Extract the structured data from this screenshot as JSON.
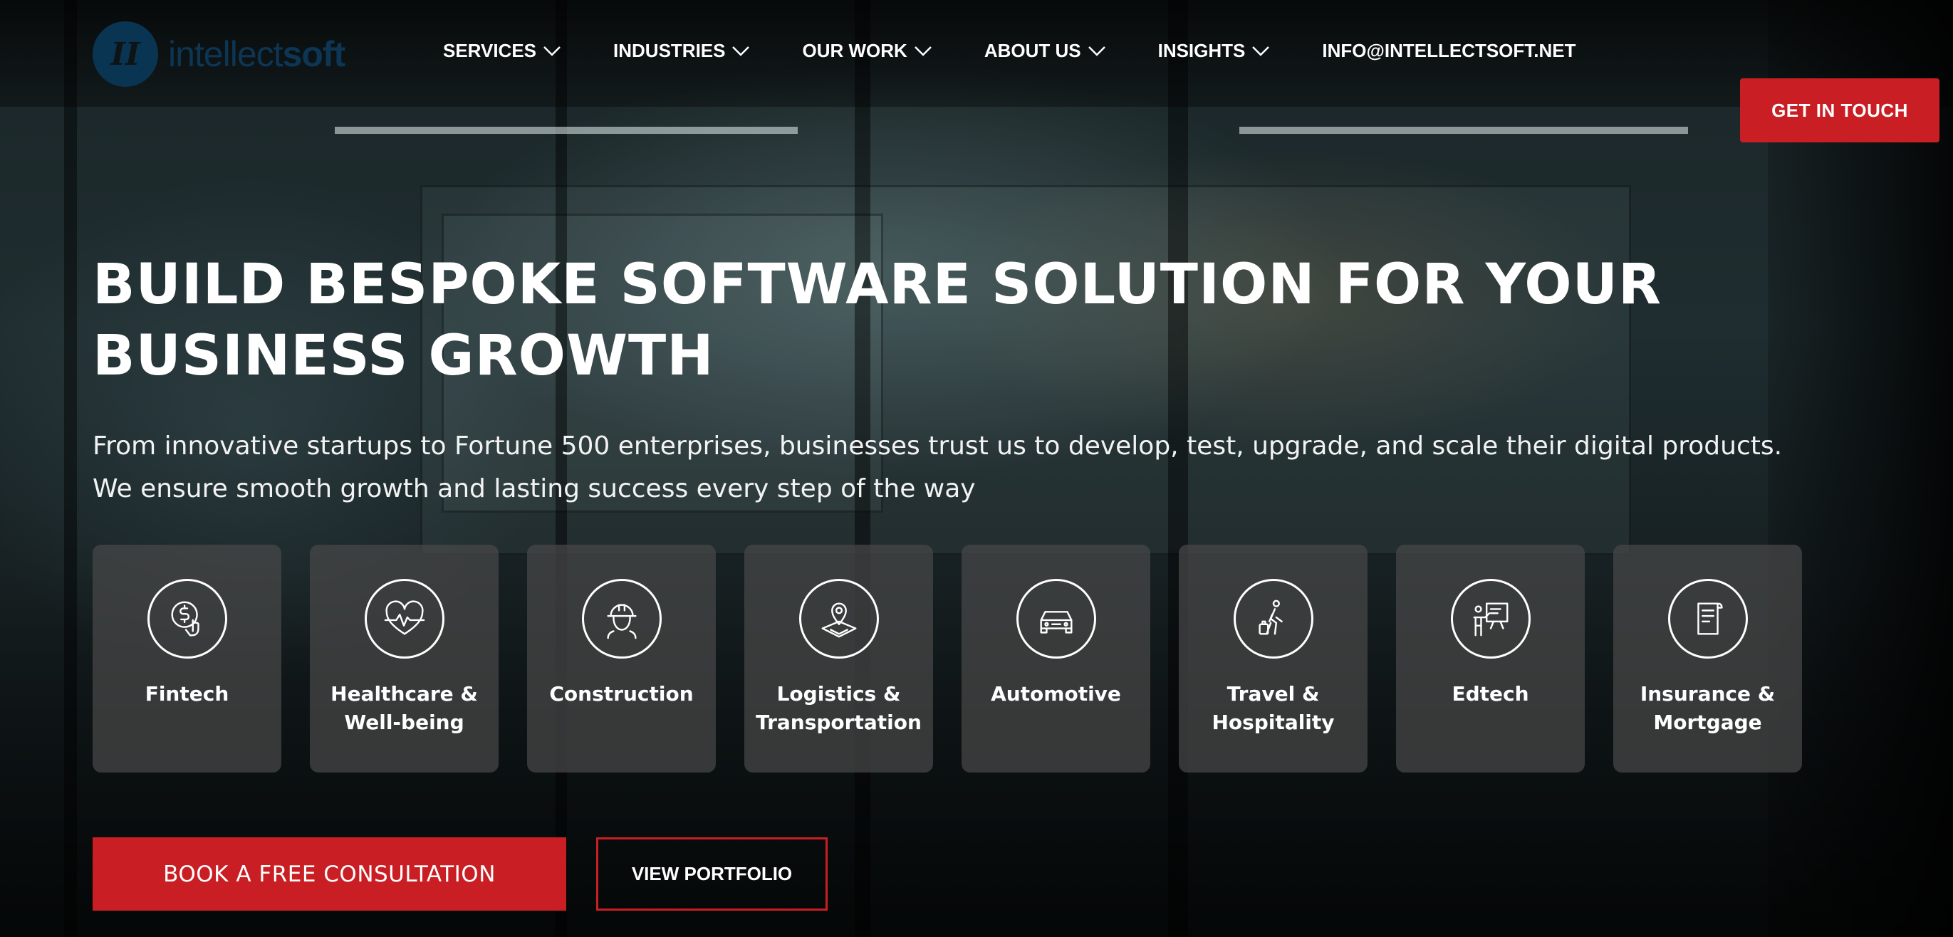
{
  "header": {
    "logo": {
      "text_light": "intellect",
      "text_bold": "soft"
    },
    "nav": [
      {
        "label": "SERVICES",
        "has_dropdown": true
      },
      {
        "label": "INDUSTRIES",
        "has_dropdown": true
      },
      {
        "label": "OUR WORK",
        "has_dropdown": true
      },
      {
        "label": "ABOUT US",
        "has_dropdown": true
      },
      {
        "label": "INSIGHTS",
        "has_dropdown": true
      },
      {
        "label": "INFO@INTELLECTSOFT.NET",
        "has_dropdown": false
      }
    ],
    "cta_label": "GET IN TOUCH"
  },
  "hero": {
    "title": "BUILD BESPOKE SOFTWARE SOLUTION FOR YOUR\nBUSINESS GROWTH",
    "subtitle": "From innovative startups to Fortune 500 enterprises, businesses trust us to develop, test, upgrade, and scale their digital products.\nWe ensure smooth growth and lasting success every step of the way"
  },
  "industries": [
    {
      "label": "Fintech",
      "icon": "fintech-icon"
    },
    {
      "label": "Healthcare &\nWell-being",
      "icon": "healthcare-icon"
    },
    {
      "label": "Construction",
      "icon": "construction-icon"
    },
    {
      "label": "Logistics &\nTransportation",
      "icon": "logistics-icon"
    },
    {
      "label": "Automotive",
      "icon": "automotive-icon"
    },
    {
      "label": "Travel &\nHospitality",
      "icon": "travel-icon"
    },
    {
      "label": "Edtech",
      "icon": "edtech-icon"
    },
    {
      "label": "Insurance &\nMortgage",
      "icon": "insurance-icon"
    }
  ],
  "actions": {
    "consult_label": "BOOK A FREE CONSULTATION",
    "portfolio_label": "VIEW PORTFOLIO"
  },
  "colors": {
    "accent_red": "#c91e23",
    "logo_blue": "#0a3552",
    "card_bg": "#484848"
  }
}
